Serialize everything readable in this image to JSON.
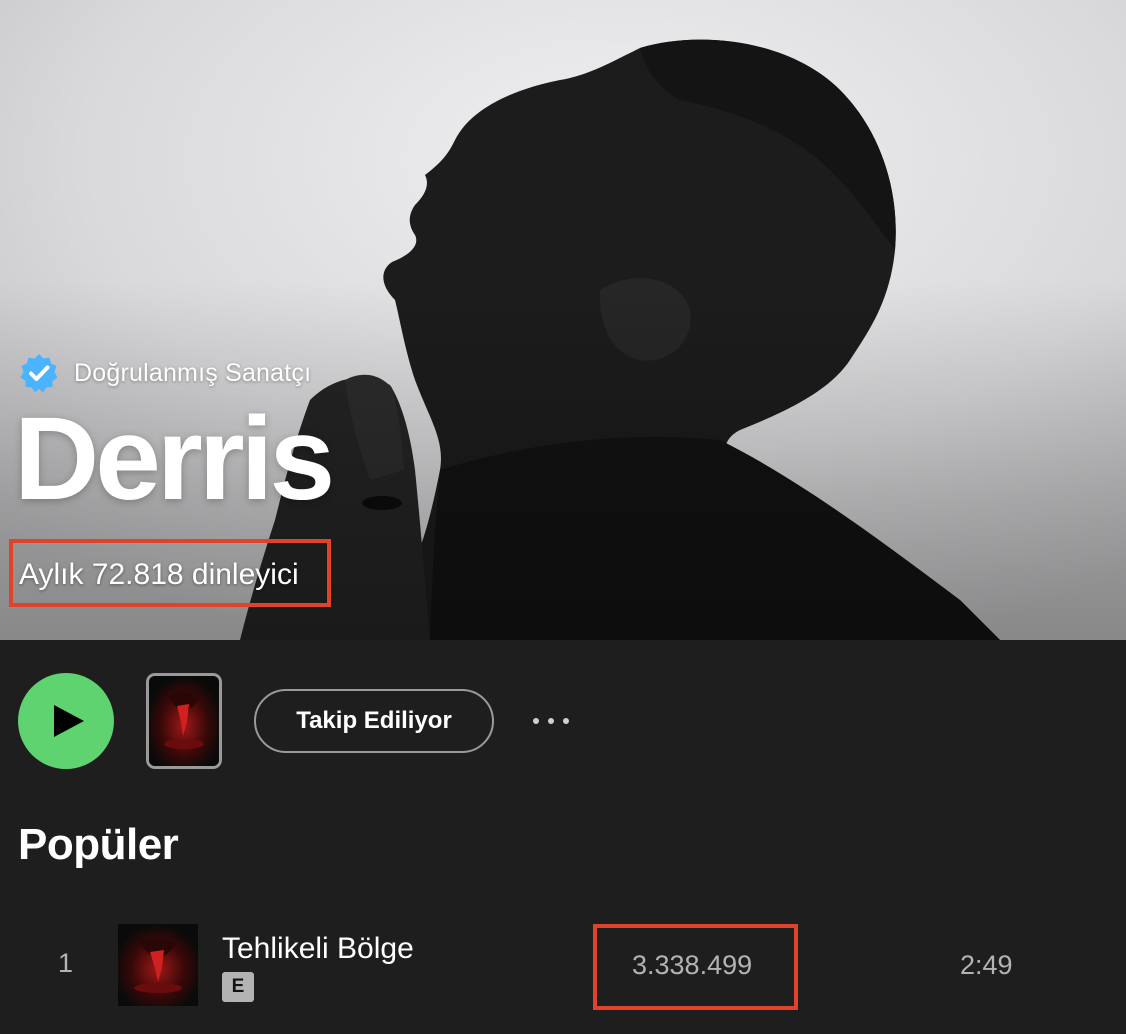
{
  "artist": {
    "verified_label": "Doğrulanmış Sanatçı",
    "name": "Derris",
    "monthly_listeners": "Aylık 72.818 dinleyici"
  },
  "actions": {
    "follow_label": "Takip Ediliyor"
  },
  "popular": {
    "title": "Popüler",
    "tracks": [
      {
        "index": "1",
        "title": "Tehlikeli Bölge",
        "explicit": "E",
        "plays": "3.338.499",
        "duration": "2:49"
      }
    ]
  },
  "colors": {
    "background": "#1e1e1e",
    "play_button": "#5fd36f",
    "verified_badge": "#4cb3ff",
    "highlight_box": "#e0432a",
    "secondary_text": "#b3b3b3"
  },
  "icons": {
    "verified": "verified-badge-icon",
    "play": "play-icon",
    "more": "more-options-icon"
  }
}
